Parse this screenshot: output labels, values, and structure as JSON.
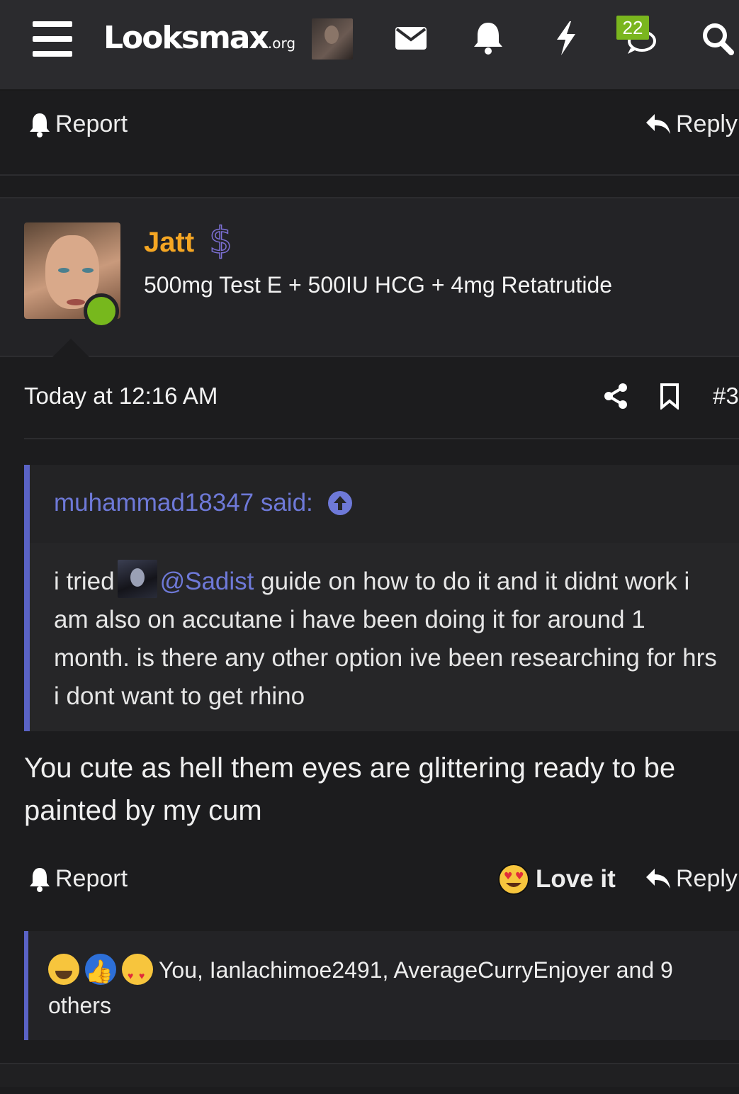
{
  "nav": {
    "logo_main": "Looksmax",
    "logo_suffix": ".org",
    "alerts_badge": "22"
  },
  "prev_post_actions": {
    "report_label": "Report",
    "reply_label": "Reply"
  },
  "post": {
    "username": "Jatt",
    "user_title": "500mg Test E + 500IU HCG + 4mg Retatrutide",
    "timestamp": "Today at 12:16 AM",
    "post_number": "#3",
    "quote": {
      "author_line": "muhammad18347 said:",
      "text_before_mention": "i tried",
      "mention": "@Sadist",
      "text_after_mention": "guide on how to do it and it didnt work i am also on accutane i have been doing it for around 1 month. is there any other option ive been researching for hrs i dont want to get rhino"
    },
    "message": "You cute as hell them eyes are glittering ready to be painted by my cum",
    "actions": {
      "report_label": "Report",
      "reaction_label": "Love it",
      "reply_label": "Reply"
    },
    "reactions_summary": "You, Ianlachimoe2491, AverageCurryEnjoyer and 9 others"
  },
  "colors": {
    "accent_blue": "#5a63c6",
    "username": "#f5a623",
    "online": "#77b81d",
    "badge": "#7ab61e"
  },
  "icons": [
    "menu-icon",
    "envelope-icon",
    "bell-icon",
    "bolt-icon",
    "chat-icon",
    "search-icon",
    "share-icon",
    "bookmark-icon",
    "reply-icon",
    "dollar-icon",
    "arrow-up-circle-icon"
  ]
}
